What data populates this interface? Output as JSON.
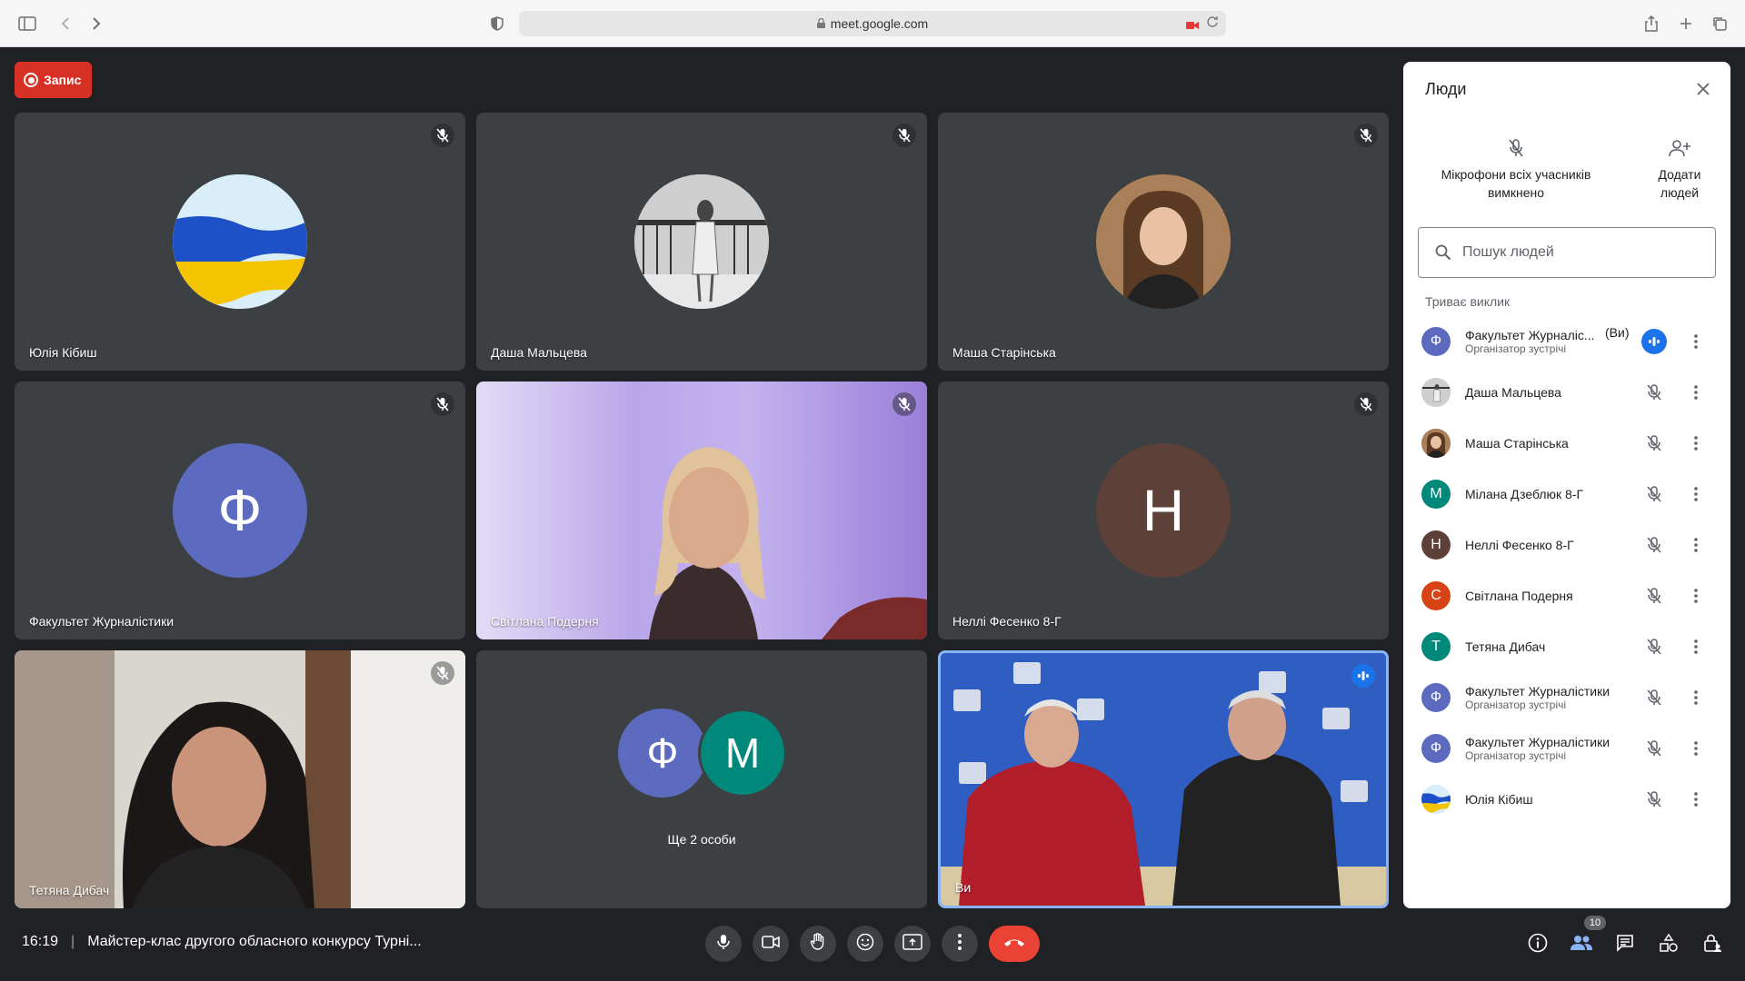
{
  "browser": {
    "url": "meet.google.com"
  },
  "recording": {
    "label": "Запис",
    "color": "#d93025"
  },
  "tiles": [
    {
      "name": "Юлія Кібиш",
      "type": "avatar-image",
      "image": "ukraine-flag",
      "muted": true
    },
    {
      "name": "Даша Мальцева",
      "type": "avatar-image",
      "image": "girl-photo-bw",
      "muted": true
    },
    {
      "name": "Маша Старінська",
      "type": "avatar-image",
      "image": "girl-portrait",
      "muted": true
    },
    {
      "name": "Факультет Журналістики",
      "type": "avatar-letter",
      "letter": "Ф",
      "color": "#5c6bc0",
      "muted": true
    },
    {
      "name": "Світлана Подерня",
      "type": "video",
      "muted": true
    },
    {
      "name": "Неллі Фесенко 8-Г",
      "type": "avatar-letter",
      "letter": "Н",
      "color": "#5d4037",
      "muted": true
    },
    {
      "name": "Тетяна Дибач",
      "type": "video",
      "muted": true
    },
    {
      "name": "",
      "type": "group",
      "letters": [
        "Ф",
        "М"
      ],
      "colors": [
        "#5c6bc0",
        "#00897b"
      ],
      "caption": "Ще 2 особи"
    },
    {
      "name": "Ви",
      "type": "video",
      "speaking": true
    }
  ],
  "meeting": {
    "time": "16:19",
    "title": "Майстер-клас другого обласного конкурсу Турні..."
  },
  "controls": [
    "mic-icon",
    "camera-icon",
    "raise-hand-icon",
    "emoji-icon",
    "present-icon",
    "more-icon",
    "hang-up-icon"
  ],
  "right_controls": {
    "participants_count": "10"
  },
  "people_panel": {
    "title": "Люди",
    "mute_all_label": "Мікрофони всіх учасників вимкнено",
    "add_people_label": "Додати людей",
    "search_placeholder": "Пошук людей",
    "section_label": "Триває виклик",
    "participants": [
      {
        "name": "Факультет Журналіс...",
        "suffix": "(Ви)",
        "role": "Організатор зустрічі",
        "letter": "Ф",
        "color": "#5c6bc0",
        "speaking": true
      },
      {
        "name": "Даша Мальцева",
        "role": "",
        "letter": "",
        "color": "#9e9e9e",
        "image": "girl-photo-bw"
      },
      {
        "name": "Маша Старінська",
        "role": "",
        "letter": "",
        "color": "#8d6e63",
        "image": "girl-portrait"
      },
      {
        "name": "Мілана Дзеблюк 8-Г",
        "role": "",
        "letter": "М",
        "color": "#00897b"
      },
      {
        "name": "Неллі Фесенко 8-Г",
        "role": "",
        "letter": "Н",
        "color": "#5d4037"
      },
      {
        "name": "Світлана Подерня",
        "role": "",
        "letter": "С",
        "color": "#d84315"
      },
      {
        "name": "Тетяна Дибач",
        "role": "",
        "letter": "Т",
        "color": "#00897b"
      },
      {
        "name": "Факультет Журналістики",
        "role": "Організатор зустрічі",
        "letter": "Ф",
        "color": "#5c6bc0"
      },
      {
        "name": "Факультет Журналістики",
        "role": "Організатор зустрічі",
        "letter": "Ф",
        "color": "#5c6bc0"
      },
      {
        "name": "Юлія Кібиш",
        "role": "",
        "letter": "",
        "color": "#ffd600",
        "image": "ukraine-flag"
      }
    ]
  }
}
